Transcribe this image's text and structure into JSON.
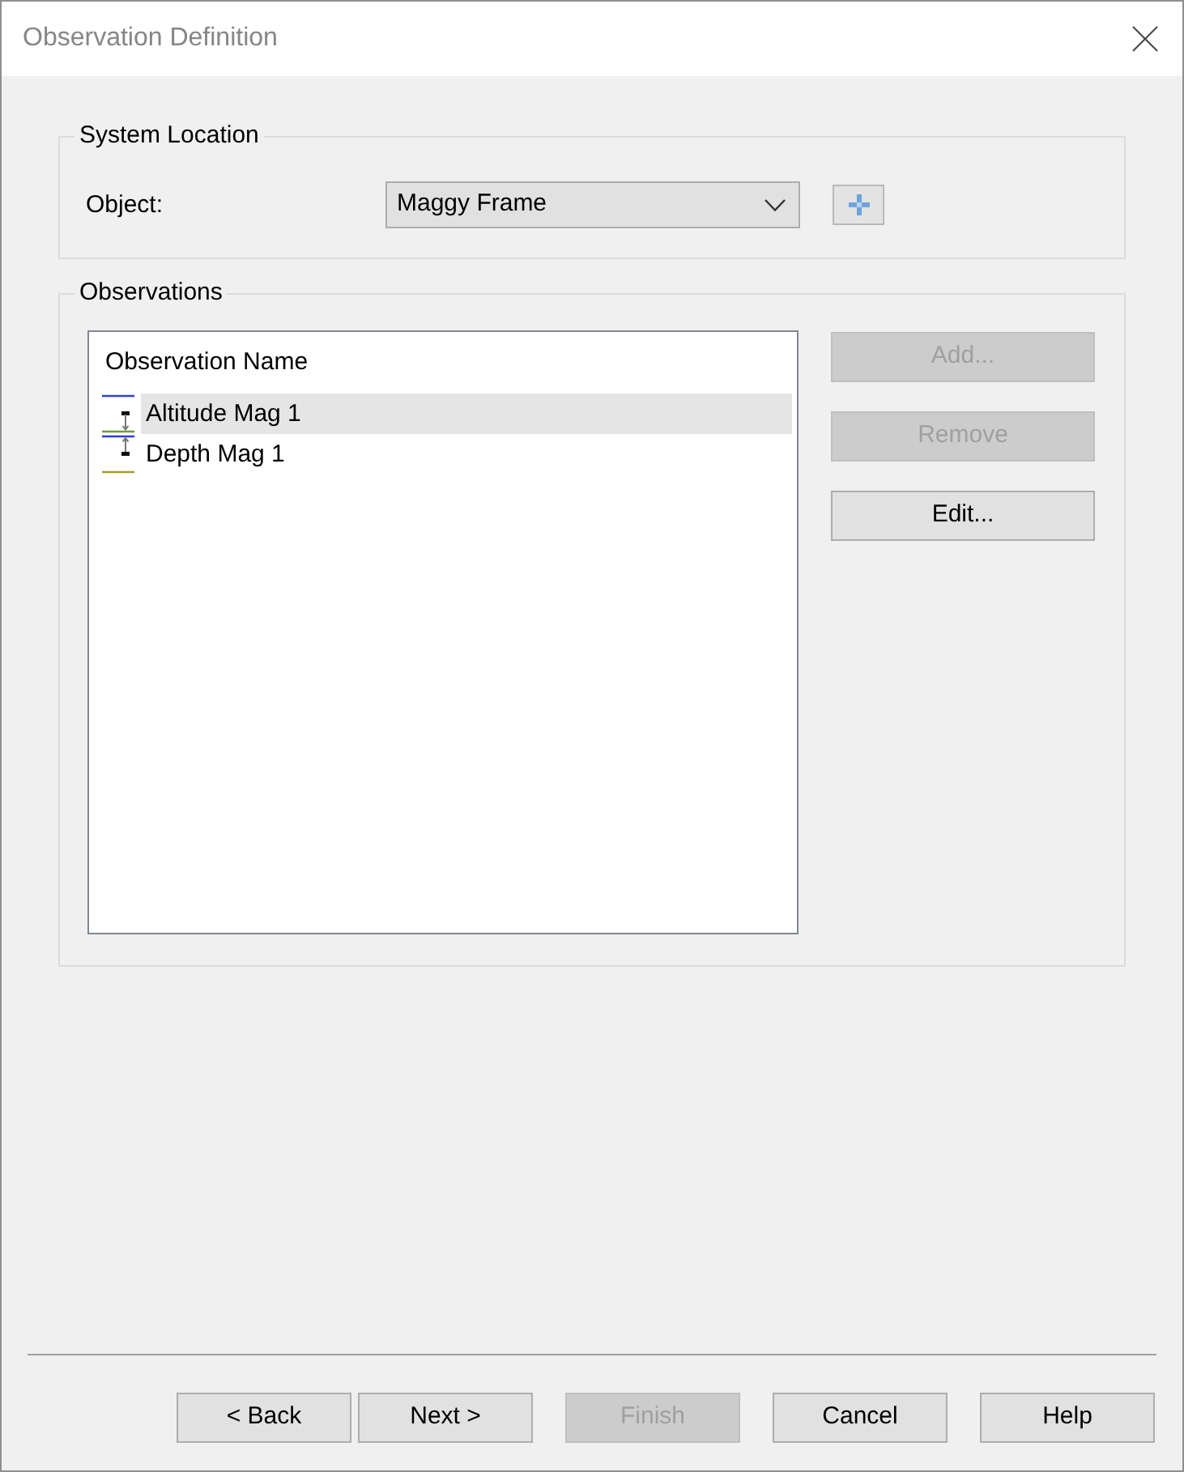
{
  "window": {
    "title": "Observation Definition"
  },
  "system_location": {
    "title": "System Location",
    "object_label": "Object:",
    "object_value": "Maggy Frame"
  },
  "observations": {
    "title": "Observations",
    "list": {
      "column": "Observation Name",
      "rows": [
        {
          "name": "Altitude Mag 1",
          "kind": "altitude",
          "selected": true
        },
        {
          "name": "Depth Mag 1",
          "kind": "depth",
          "selected": false
        }
      ]
    },
    "buttons": [
      {
        "label": "Add...",
        "disabled": true
      },
      {
        "label": "Remove",
        "disabled": true
      },
      {
        "label": "Edit...",
        "disabled": false
      }
    ]
  },
  "footer_buttons": [
    {
      "label": "< Back",
      "disabled": false
    },
    {
      "label": "Next >",
      "disabled": false
    },
    {
      "label": "Finish",
      "disabled": true
    },
    {
      "label": "Cancel",
      "disabled": false
    },
    {
      "label": "Help",
      "disabled": false
    }
  ]
}
